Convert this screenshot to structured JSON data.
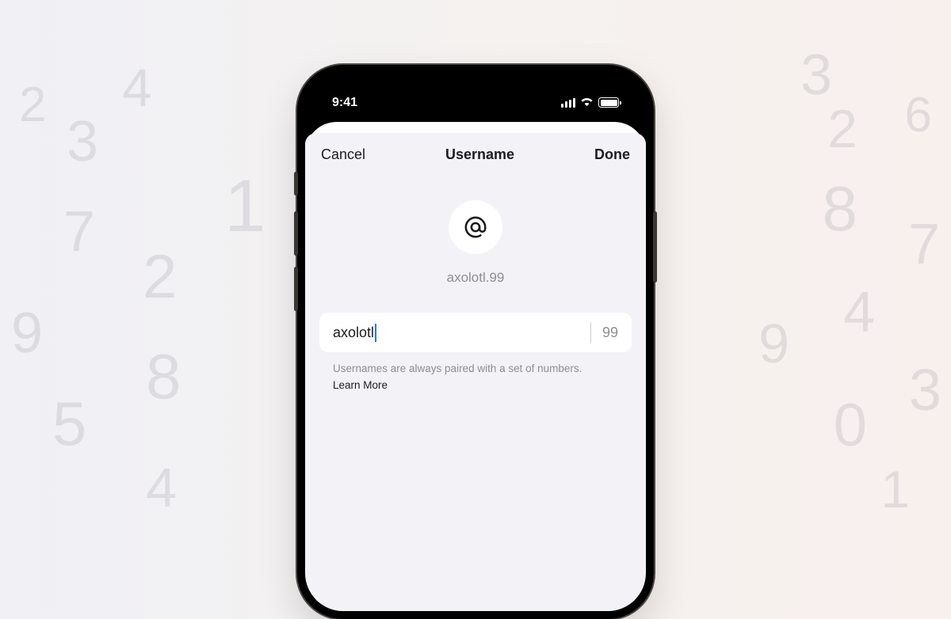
{
  "background_numbers": {
    "left": [
      "2",
      "4",
      "3",
      "1",
      "7",
      "2",
      "9",
      "8",
      "5",
      "4"
    ],
    "right": [
      "3",
      "6",
      "2",
      "8",
      "7",
      "4",
      "9",
      "0",
      "3",
      "1"
    ]
  },
  "status_bar": {
    "time": "9:41"
  },
  "sheet": {
    "cancel_label": "Cancel",
    "title": "Username",
    "done_label": "Done",
    "username_display": "axolotl.99",
    "input_value": "axolotl",
    "suffix_value": "99",
    "hint_text": "Usernames are always paired with a set of numbers.",
    "learn_more_label": "Learn More"
  }
}
